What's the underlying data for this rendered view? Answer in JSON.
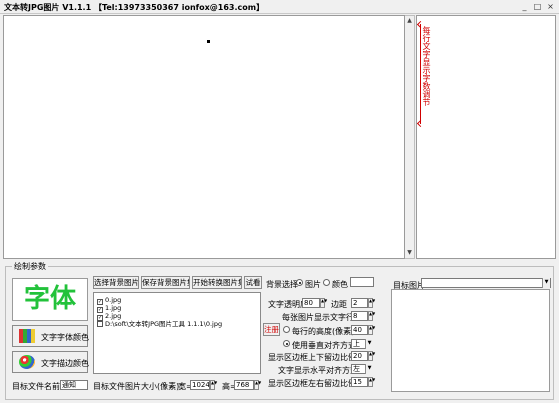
{
  "window": {
    "title": "文本转JPG图片 V1.1.1    【Tel:13973350367   ionfox@163.com】",
    "min_glyph": "_",
    "max_glyph": "□",
    "close_glyph": "×"
  },
  "side_note": "每行文字显示字数调节",
  "draw_group": {
    "label": "绘制参数",
    "font_preview": "字体",
    "text_font_btn": "文字字体颜色",
    "text_border_btn": "文字描边颜色",
    "target_name_label": "目标文件名前缀",
    "target_name_value": "通知"
  },
  "buttons": {
    "choose_bg": "选择背景图片",
    "save_bg": "保存背景图片集",
    "start_convert": "开始转换图片集",
    "test": "试看",
    "register": "注册"
  },
  "bg_choice": {
    "label": "背景选择",
    "option_image": "图片",
    "option_color": "颜色"
  },
  "file_list": [
    {
      "checked": true,
      "text": "0.jpg"
    },
    {
      "checked": true,
      "text": "1.jpg"
    },
    {
      "checked": true,
      "text": "2.jpg"
    },
    {
      "checked": false,
      "text": "D:\\soft\\文本转JPG图片工具 1.1.1\\0.jpg"
    }
  ],
  "target_size": {
    "label": "目标文件图片大小(像素)：",
    "width_label": "宽=",
    "width_value": "1024",
    "height_label": "高=",
    "height_value": "768"
  },
  "settings": {
    "transparency_label": "文字透明度",
    "transparency_value": "80",
    "margin_label": "边距",
    "margin_value": "2",
    "lines_label": "每张图片显示文字行数",
    "lines_value": "8",
    "line_height_label": "每行的高度(像素)",
    "line_height_value": "40",
    "vcenter_label": "使用垂直对齐方式",
    "vcenter_value": "上",
    "tb_gap_label": "显示区边框上下留边比例%",
    "tb_gap_value": "20",
    "h_align_label": "文字显示水平对齐方式",
    "h_align_value": "左",
    "lr_gap_label": "显示区边框左右留边比例%",
    "lr_gap_value": "15"
  },
  "target_image": {
    "label": "目标图片",
    "value": ""
  }
}
